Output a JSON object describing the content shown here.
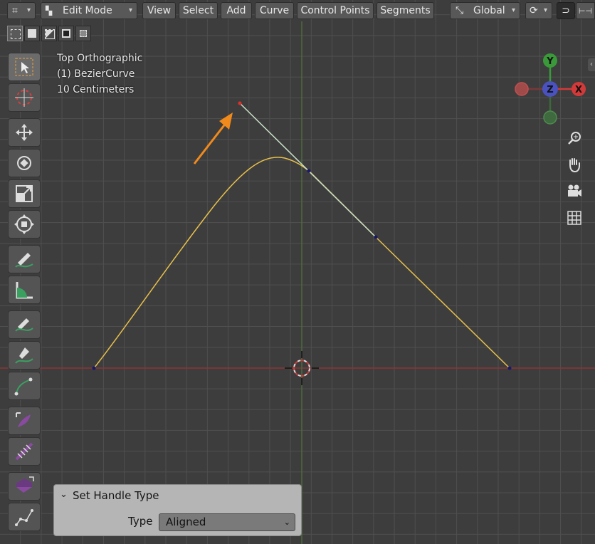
{
  "header": {
    "mode_label": "Edit Mode",
    "menus": [
      "View",
      "Select",
      "Add",
      "Curve",
      "Control Points",
      "Segments"
    ],
    "orientation_label": "Global"
  },
  "viewport": {
    "view_name": "Top Orthographic",
    "object_name": "(1) BezierCurve",
    "scale_label": "10 Centimeters"
  },
  "gizmo": {
    "axes": [
      "Y",
      "Z",
      "X"
    ],
    "colors": {
      "x": "#d23a3a",
      "y": "#3a9a3a",
      "z": "#4a52c0"
    }
  },
  "nav_icons": [
    "zoom-icon",
    "hand-icon",
    "camera-icon",
    "grid-icon"
  ],
  "tools": [
    "select-box",
    "cursor",
    "move",
    "rotate",
    "scale",
    "transform",
    "annotate",
    "measure",
    "draw",
    "pen",
    "curve-pen",
    "tilt",
    "randomize",
    "extrude",
    "radius"
  ],
  "panel": {
    "title": "Set Handle Type",
    "type_label": "Type",
    "type_value": "Aligned"
  },
  "colors": {
    "curve": "#e8c04a",
    "handle": "#c8e0c8",
    "x_axis": "#8a3a3a",
    "y_axis": "#4a6a3a",
    "arrow": "#f08a1c",
    "accent": "#d0d0d0"
  }
}
